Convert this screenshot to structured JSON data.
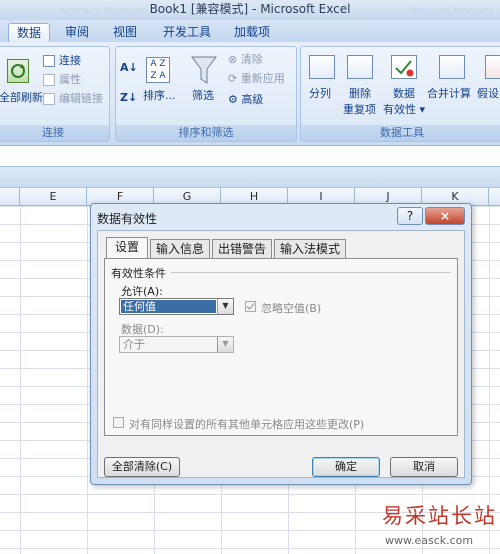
{
  "window": {
    "title": "Book1  [兼容模式] - Microsoft Excel",
    "ghost_left": "Nomacs  Nomacs",
    "ghost_right": "Nomacs  Nomacs"
  },
  "ribbon_tabs": [
    "数据",
    "审阅",
    "视图",
    "开发工具",
    "加载项"
  ],
  "ribbon": {
    "conn": {
      "refresh_label": "全部刷新",
      "connections": "连接",
      "properties": "属性",
      "edit_links": "编辑链接",
      "group_label": "连接"
    },
    "sort": {
      "sort_label": "排序...",
      "filter_label": "筛选",
      "clear": "清除",
      "reapply": "重新应用",
      "advanced": "高级",
      "group_label": "排序和筛选"
    },
    "tools": {
      "text_to_columns": "分列",
      "remove_dup_1": "删除",
      "remove_dup_2": "重复项",
      "validation_1": "数据",
      "validation_2": "有效性",
      "consolidate": "合并计算",
      "whatif": "假设",
      "group_label": "数据工具"
    }
  },
  "sheet": {
    "columns": [
      "E",
      "F",
      "G",
      "H",
      "I",
      "J",
      "K"
    ]
  },
  "dialog": {
    "title": "数据有效性",
    "help": "?",
    "close": "×",
    "tabs": [
      "设置",
      "输入信息",
      "出错警告",
      "输入法模式"
    ],
    "section_label": "有效性条件",
    "allow_label": "允许(A):",
    "allow_value": "任何值",
    "ignore_blank": "忽略空值(B)",
    "data_label": "数据(D):",
    "data_value": "介于",
    "apply_all": "对有同样设置的所有其他单元格应用这些更改(P)",
    "clear_all": "全部清除(C)",
    "ok": "确定",
    "cancel": "取消"
  },
  "watermark": {
    "text": "易采站长站",
    "url": "www.easck.com"
  }
}
